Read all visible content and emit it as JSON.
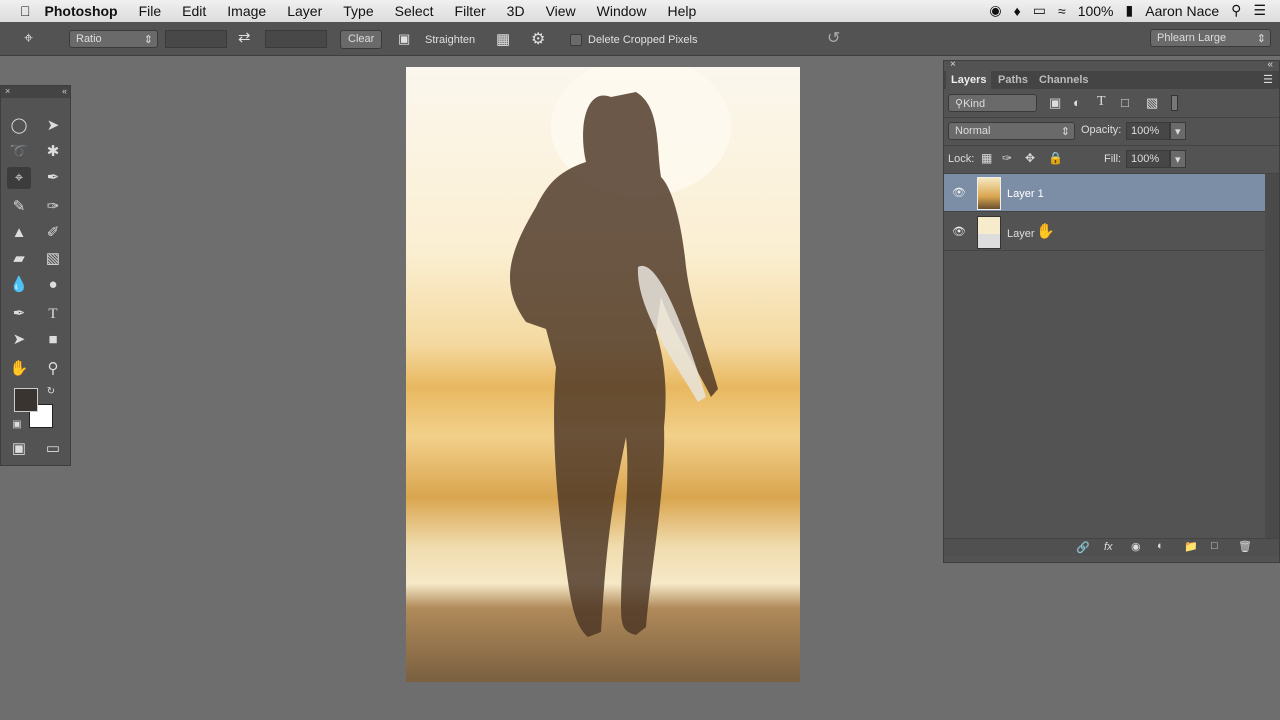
{
  "menubar": {
    "app": "Photoshop",
    "items": [
      "File",
      "Edit",
      "Image",
      "Layer",
      "Type",
      "Select",
      "Filter",
      "3D",
      "View",
      "Window",
      "Help"
    ],
    "battery": "100%",
    "user": "Aaron Nace"
  },
  "options": {
    "ratio": "Ratio",
    "clear": "Clear",
    "straighten": "Straighten",
    "delete_cropped": "Delete Cropped Pixels",
    "workspace": "Phlearn Large"
  },
  "layers_panel": {
    "tabs": [
      "Layers",
      "Paths",
      "Channels"
    ],
    "filter": "Kind",
    "blend_mode": "Normal",
    "opacity_label": "Opacity:",
    "opacity": "100%",
    "lock_label": "Lock:",
    "fill_label": "Fill:",
    "fill": "100%",
    "layers": [
      {
        "name": "Layer 1",
        "selected": true,
        "visible": true
      },
      {
        "name": "Layer",
        "selected": false,
        "visible": true
      }
    ]
  },
  "colors": {
    "selected_layer": "#7b8ea6",
    "panel": "#535353",
    "canvas_bg": "#6e6e6e"
  }
}
